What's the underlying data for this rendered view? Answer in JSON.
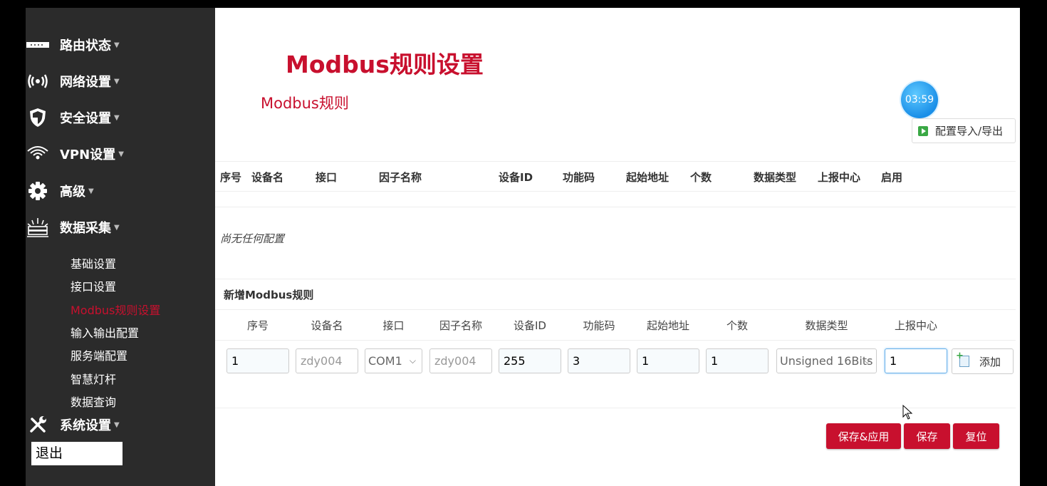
{
  "sidebar": {
    "menu": [
      {
        "label": "路由状态",
        "icon": "router-icon"
      },
      {
        "label": "网络设置",
        "icon": "wireless-icon"
      },
      {
        "label": "安全设置",
        "icon": "shield-icon"
      },
      {
        "label": "VPN设置",
        "icon": "wifi-icon"
      },
      {
        "label": "高级",
        "icon": "gear-icon"
      },
      {
        "label": "数据采集",
        "icon": "data-collect-icon"
      }
    ],
    "submenu": [
      "基础设置",
      "接口设置",
      "Modbus规则设置",
      "输入输出配置",
      "服务端配置",
      "智慧灯杆",
      "数据查询"
    ],
    "system": {
      "label": "系统设置",
      "icon": "tools-icon"
    },
    "logout": "退出"
  },
  "main": {
    "title": "Modbus规则设置",
    "section": "Modbus规则",
    "timer": "03:59",
    "import_export": "配置导入/导出",
    "table_headers": [
      "序号",
      "设备名",
      "接口",
      "因子名称",
      "设备ID",
      "功能码",
      "起始地址",
      "个数",
      "数据类型",
      "上报中心",
      "启用"
    ],
    "empty_text": "尚无任何配置",
    "new_rule_title": "新增Modbus规则",
    "form_headers": [
      "序号",
      "设备名",
      "接口",
      "因子名称",
      "设备ID",
      "功能码",
      "起始地址",
      "个数",
      "数据类型",
      "上报中心"
    ],
    "form": {
      "seq": "1",
      "device_name_placeholder": "zdy004",
      "interface": "COM1",
      "factor_placeholder": "zdy004",
      "device_id": "255",
      "function_code": "3",
      "start_address": "1",
      "count": "1",
      "data_type": "Unsigned 16Bits",
      "report_center": "1"
    },
    "add_button": "添加",
    "buttons": {
      "save_apply": "保存&应用",
      "save": "保存",
      "reset": "复位"
    }
  },
  "colors": {
    "accent": "#c8102e",
    "sidebar_bg": "#2b2b2b"
  }
}
